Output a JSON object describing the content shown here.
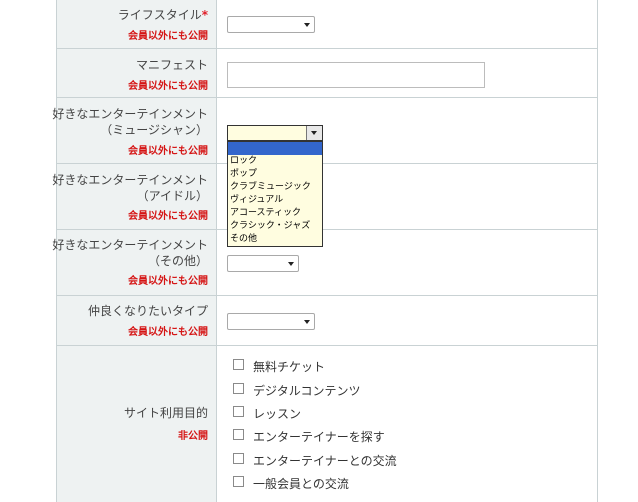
{
  "fields": {
    "lifestyle": {
      "label": "ライフスタイル",
      "required_mark": "*",
      "visibility": "会員以外にも公開"
    },
    "manifest": {
      "label": "マニフェスト",
      "visibility": "会員以外にも公開"
    },
    "ent_music": {
      "label_line1": "好きなエンターテインメント",
      "label_line2": "（ミュージシャン）",
      "visibility": "会員以外にも公開",
      "options": [
        "",
        "ロック",
        "ポップ",
        "クラブミュージック",
        "ヴィジュアル",
        "アコースティック",
        "クラシック・ジャズ",
        "その他"
      ]
    },
    "ent_idol": {
      "label_line1": "好きなエンターテインメント",
      "label_line2": "（アイドル）",
      "visibility": "会員以外にも公開"
    },
    "ent_other": {
      "label_line1": "好きなエンターテインメント",
      "label_line2": "（その他）",
      "visibility": "会員以外にも公開"
    },
    "friend_type": {
      "label": "仲良くなりたいタイプ",
      "visibility": "会員以外にも公開"
    },
    "purpose": {
      "label": "サイト利用目的",
      "visibility": "非公開",
      "checkboxes": [
        "無料チケット",
        "デジタルコンテンツ",
        "レッスン",
        "エンターテイナーを探す",
        "エンターテイナーとの交流",
        "一般会員との交流"
      ]
    }
  },
  "colors": {
    "label_bg": "#eef2f2",
    "border": "#c9d2d4",
    "visibility_red": "#d51515",
    "dropdown_bg": "#fffde0",
    "highlight": "#3366cc"
  }
}
